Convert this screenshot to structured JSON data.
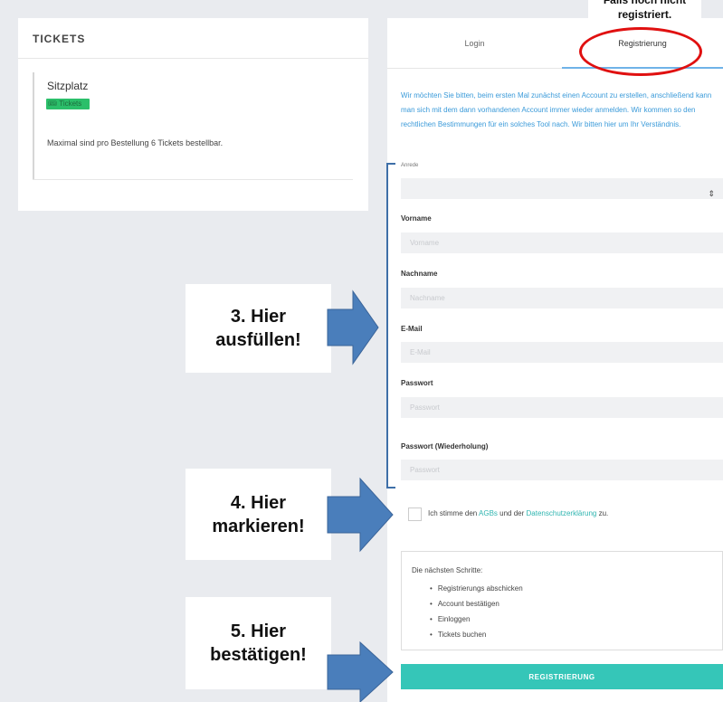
{
  "tickets": {
    "title": "TICKETS",
    "item_name": "Sitzplatz",
    "badge": "🎟 Tickets",
    "note": "Maximal sind pro Bestellung 6 Tickets bestellbar."
  },
  "tabs": {
    "login": "Login",
    "register": "Registrierung"
  },
  "callouts": {
    "top_line1": "Falls noch nicht",
    "top_line2": "registriert.",
    "step3_line1": "3. Hier",
    "step3_line2": "ausfüllen!",
    "step4_line1": "4. Hier",
    "step4_line2": "markieren!",
    "step5_line1": "5. Hier",
    "step5_line2": "bestätigen!"
  },
  "intro_text": "Wir möchten Sie bitten, beim ersten Mal zunächst einen Account zu erstellen, anschließend kann man sich mit dem dann vorhandenen Account immer wieder anmelden. Wir kommen so den rechtlichen Bestimmungen für ein solches Tool nach. Wir bitten hier um Ihr Verständnis.",
  "form": {
    "salutation_label": "Anrede",
    "salutation_value": "",
    "firstname_label": "Vorname",
    "firstname_placeholder": "Vorname",
    "lastname_label": "Nachname",
    "lastname_placeholder": "Nachname",
    "email_label": "E-Mail",
    "email_placeholder": "E-Mail",
    "password_label": "Passwort",
    "password_placeholder": "Passwort",
    "password_repeat_label": "Passwort (Wiederholung)",
    "password_repeat_placeholder": "Passwort"
  },
  "consent": {
    "prefix": "Ich stimme den ",
    "agb": "AGBs",
    "middle": " und der ",
    "privacy": "Datenschutzerklärung",
    "suffix": " zu.",
    "checked": false
  },
  "next_steps": {
    "title": "Die nächsten Schritte:",
    "items": [
      "Registrierungs abschicken",
      "Account bestätigen",
      "Einloggen",
      "Tickets buchen"
    ]
  },
  "submit_label": "REGISTRIERUNG",
  "colors": {
    "accent_teal": "#35c6b8",
    "link_blue": "#3a9ad9",
    "badge_green": "#2bbf6a",
    "annotation_red": "#e01010",
    "arrow_blue": "#4a7ebb"
  }
}
